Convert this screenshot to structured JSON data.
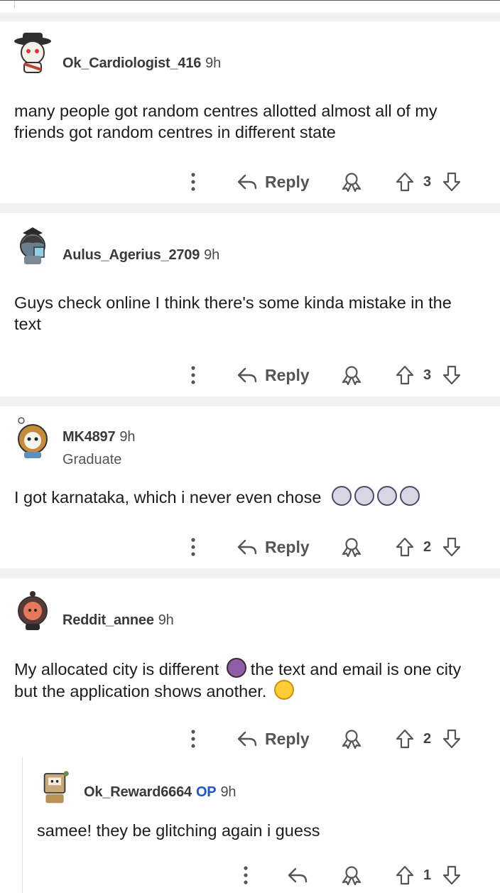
{
  "comments": [
    {
      "username": "Ok_Cardiologist_416",
      "time": "9h",
      "text": "many people got random centres allotted almost all of my friends got random centres in different state",
      "reply_label": "Reply",
      "score": "3"
    },
    {
      "username": "Aulus_Agerius_2709",
      "time": "9h",
      "text": "Guys check online I think there's some kinda mistake in the text",
      "reply_label": "Reply",
      "score": "3"
    },
    {
      "username": "MK4897",
      "time": "9h",
      "flair": "Graduate",
      "text": "I got karnataka, which i never even chose",
      "emoji": [
        "woman-facepalming-emoji",
        "woman-facepalming-emoji",
        "woman-facepalming-emoji",
        "woman-facepalming-emoji"
      ],
      "reply_label": "Reply",
      "score": "2"
    },
    {
      "username": "Reddit_annee",
      "time": "9h",
      "text_part1": "My allocated city is different",
      "text_part2": "the text and email is one city but the application shows another.",
      "emoji": [
        "woman-shrugging-emoji",
        "thinking-face-emoji"
      ],
      "reply_label": "Reply",
      "score": "2"
    },
    {
      "username": "Ok_Reward6664",
      "op_badge": "OP",
      "time": "9h",
      "text": "samee! they be glitching again i guess",
      "score": "1"
    }
  ],
  "icons": {
    "more": "more-vertical-icon",
    "reply": "reply-arrow-icon",
    "award": "award-icon",
    "upvote": "upvote-arrow-icon",
    "downvote": "downvote-arrow-icon"
  },
  "colors": {
    "separator": "#f0f1f3",
    "op": "#1e56d0",
    "icon": "#555555"
  }
}
